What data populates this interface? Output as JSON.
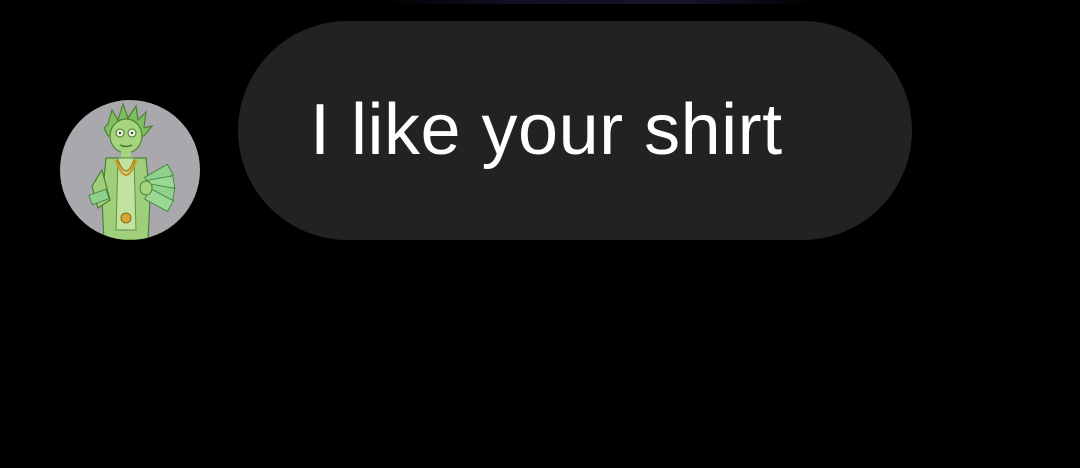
{
  "conversation": {
    "messages": [
      {
        "direction": "incoming",
        "text": "I like your shirt",
        "avatar_icon": "rick-character-avatar"
      }
    ]
  },
  "colors": {
    "background": "#000000",
    "bubble": "#222222",
    "bubble_text": "#ffffff",
    "avatar_background": "#a9a9ad"
  }
}
